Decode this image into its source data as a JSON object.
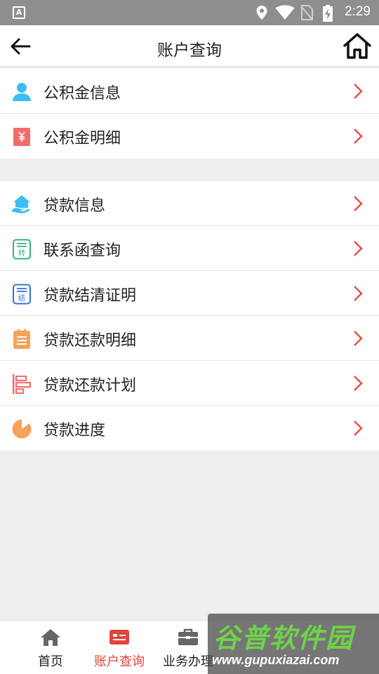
{
  "status_bar": {
    "left_icon_letter": "A",
    "time": "2:29",
    "icons": [
      "location-icon",
      "wifi-icon",
      "no-sim-icon",
      "battery-charging-icon"
    ]
  },
  "header": {
    "back_icon": "back-arrow-icon",
    "title": "账户查询",
    "home_icon": "home-icon"
  },
  "menu_groups": [
    {
      "items": [
        {
          "label": "公积金信息",
          "icon": "user-icon",
          "color": "#3dbdf2"
        },
        {
          "label": "公积金明细",
          "icon": "yuan-doc-icon",
          "color": "#f26b6b"
        }
      ]
    },
    {
      "items": [
        {
          "label": "贷款信息",
          "icon": "house-hand-icon",
          "color": "#3dbdf2"
        },
        {
          "label": "联系函查询",
          "icon": "transfer-doc-icon",
          "color": "#35b07a"
        },
        {
          "label": "贷款结清证明",
          "icon": "settle-doc-icon",
          "color": "#3b6fd1"
        },
        {
          "label": "贷款还款明细",
          "icon": "clipboard-icon",
          "color": "#f5a35b"
        },
        {
          "label": "贷款还款计划",
          "icon": "plan-bars-icon",
          "color": "#f26b6b"
        },
        {
          "label": "贷款进度",
          "icon": "pie-progress-icon",
          "color": "#f5a35b"
        }
      ]
    }
  ],
  "chevron_color": "#e0524a",
  "tab_bar": {
    "tabs": [
      {
        "label": "首页",
        "icon": "home-icon",
        "active": false
      },
      {
        "label": "账户查询",
        "icon": "id-card-icon",
        "active": true
      },
      {
        "label": "业务办理",
        "icon": "briefcase-icon",
        "active": false
      }
    ],
    "active_color": "#e0443c"
  },
  "watermark": {
    "title": "谷普软件园",
    "url": "www.gupuxiazai.com"
  }
}
